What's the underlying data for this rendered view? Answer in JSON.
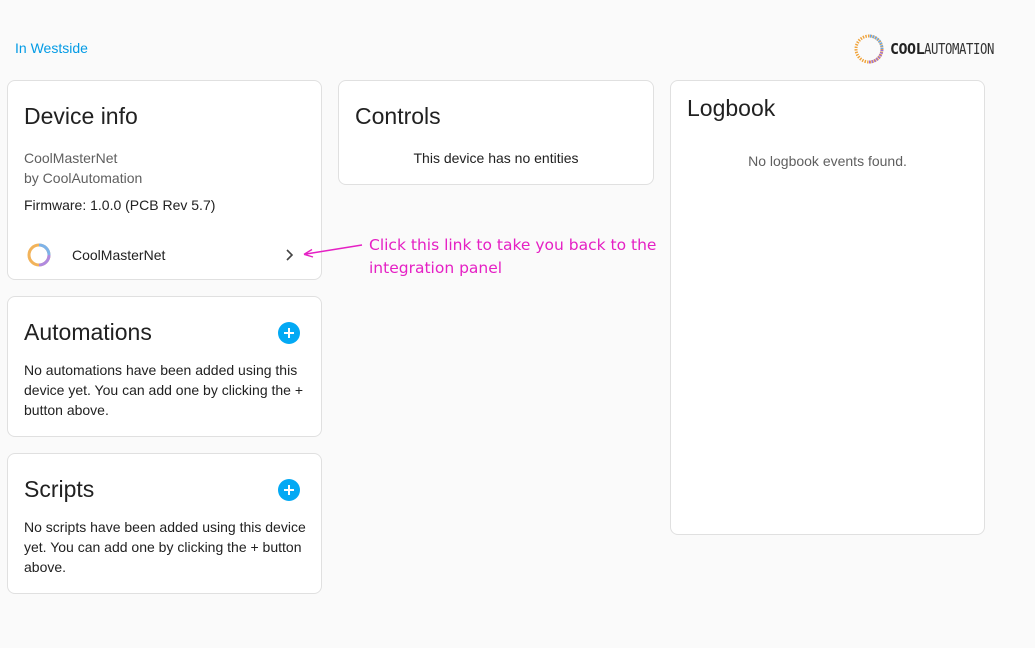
{
  "breadcrumb": {
    "area_link": "In Westside"
  },
  "brand": {
    "bold": "COOL",
    "light": "AUTOMATION"
  },
  "device_info": {
    "title": "Device info",
    "model": "CoolMasterNet",
    "manufacturer": "by CoolAutomation",
    "firmware": "Firmware: 1.0.0 (PCB Rev 5.7)",
    "integration_name": "CoolMasterNet"
  },
  "controls": {
    "title": "Controls",
    "empty_text": "This device has no entities"
  },
  "logbook": {
    "title": "Logbook",
    "empty_text": "No logbook events found."
  },
  "automations": {
    "title": "Automations",
    "empty_text": "No automations have been added using this device yet. You can add one by clicking the + button above."
  },
  "scripts": {
    "title": "Scripts",
    "empty_text": "No scripts have been added using this device yet. You can add one by clicking the + button above."
  },
  "annotation": {
    "text": "Click this link to take you back to the integration panel",
    "color": "#e520c4"
  },
  "colors": {
    "accent": "#03a9f4",
    "link": "#039be5",
    "background": "#fafafa"
  },
  "icons": {
    "brand_logo": "coolautomation-ring-logo",
    "integration_logo": "coolautomation-ring-icon",
    "chevron": "chevron-right-icon",
    "add": "plus-circle-icon",
    "arrow": "annotation-arrow-icon"
  }
}
